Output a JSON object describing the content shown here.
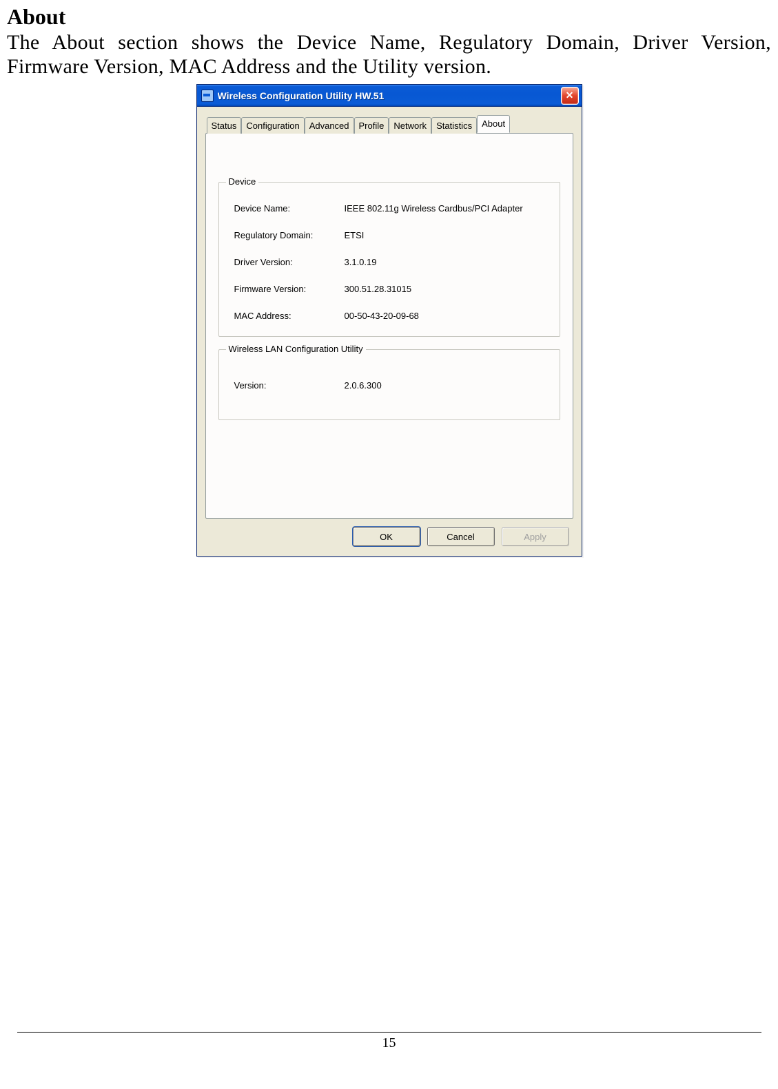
{
  "doc": {
    "heading": "About",
    "intro": "The About section shows the Device Name, Regulatory Domain, Driver Version, Firmware Version, MAC Address and the Utility version.",
    "page_number": "15"
  },
  "dialog": {
    "title": "Wireless Configuration Utility HW.51",
    "tabs": [
      {
        "label": "Status"
      },
      {
        "label": "Configuration"
      },
      {
        "label": "Advanced"
      },
      {
        "label": "Profile"
      },
      {
        "label": "Network"
      },
      {
        "label": "Statistics"
      },
      {
        "label": "About"
      }
    ],
    "active_tab": "About",
    "device_group": {
      "legend": "Device",
      "rows": [
        {
          "label": "Device Name:",
          "value": "IEEE 802.11g Wireless Cardbus/PCI Adapter"
        },
        {
          "label": "Regulatory Domain:",
          "value": "ETSI"
        },
        {
          "label": "Driver Version:",
          "value": "3.1.0.19"
        },
        {
          "label": "Firmware Version:",
          "value": "300.51.28.31015"
        },
        {
          "label": "MAC Address:",
          "value": "00-50-43-20-09-68"
        }
      ]
    },
    "utility_group": {
      "legend": "Wireless LAN Configuration Utility",
      "rows": [
        {
          "label": "Version:",
          "value": "2.0.6.300"
        }
      ]
    },
    "buttons": {
      "ok": "OK",
      "cancel": "Cancel",
      "apply": "Apply"
    }
  }
}
